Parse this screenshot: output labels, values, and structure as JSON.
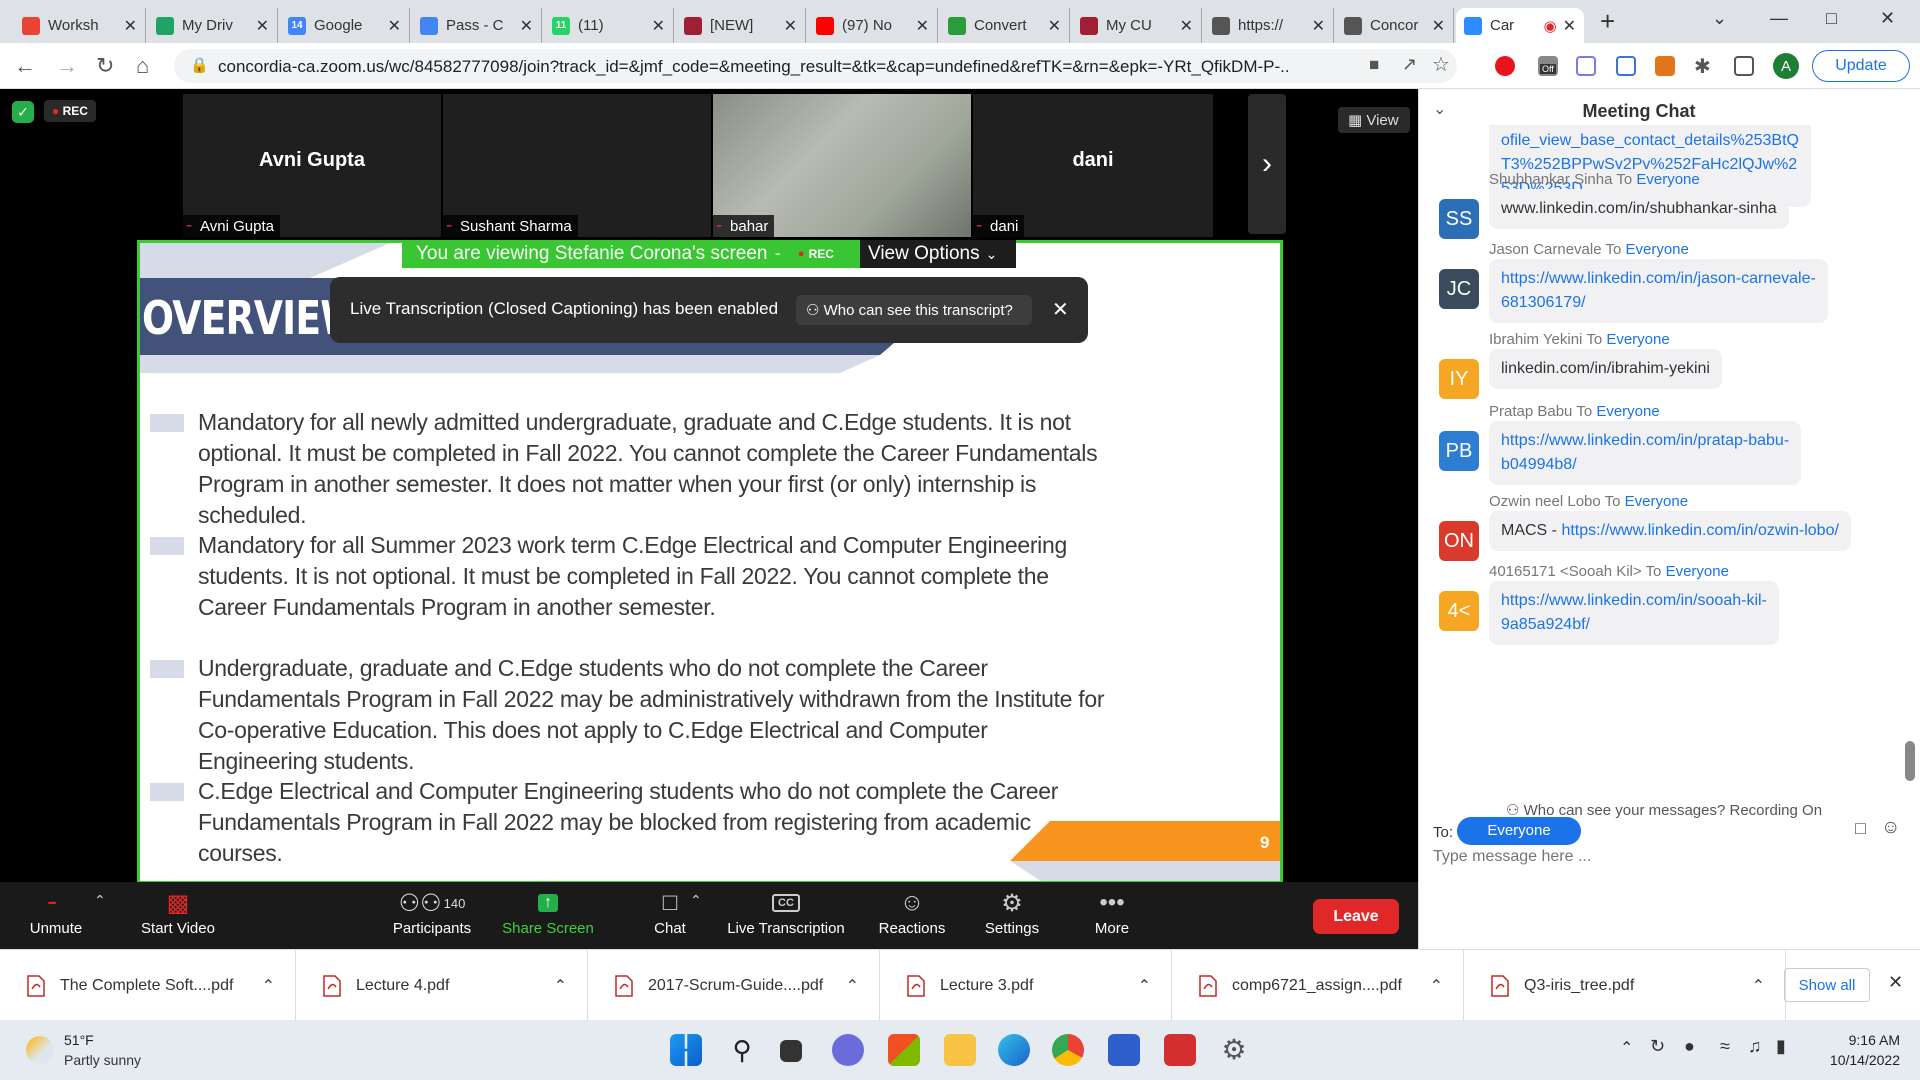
{
  "browser": {
    "tabs": [
      {
        "label": "Worksh",
        "icon": "gmail-icon",
        "color": "#ea4335"
      },
      {
        "label": "My Driv",
        "icon": "drive-icon",
        "color": "#1fa463"
      },
      {
        "label": "Google",
        "icon": "calendar-icon",
        "color": "#4285f4",
        "badge": "14"
      },
      {
        "label": "Pass - C",
        "icon": "docs-icon",
        "color": "#4285f4"
      },
      {
        "label": "(11)",
        "icon": "whatsapp-icon",
        "color": "#25d366",
        "badge": "11"
      },
      {
        "label": "[NEW]",
        "icon": "moodle-icon",
        "color": "#a01f32"
      },
      {
        "label": "(97) No",
        "icon": "youtube-icon",
        "color": "#ff0000"
      },
      {
        "label": "Convert",
        "icon": "convert-icon",
        "color": "#2a9d3a"
      },
      {
        "label": "My CU",
        "icon": "moodle-icon",
        "color": "#a01f32"
      },
      {
        "label": "https://",
        "icon": "globe-icon",
        "color": "#555555"
      },
      {
        "label": "Concor",
        "icon": "globe-icon",
        "color": "#555555"
      },
      {
        "label": "Car",
        "icon": "zoom-icon",
        "color": "#2d8cff"
      }
    ],
    "url": "concordia-ca.zoom.us/wc/84582777098/join?track_id=&jmf_code=&meeting_result=&tk=&cap=undefined&refTK=&rn=&epk=-YRt_QfikDM-P-...",
    "update_label": "Update",
    "profile_letter": "A",
    "off_badge": "Off"
  },
  "zoom": {
    "rec_label": "REC",
    "view_label": "View",
    "participants": [
      {
        "big_name": "Avni Gupta",
        "label": "Avni Gupta"
      },
      {
        "big_name": "",
        "label": "Sushant Sharma"
      },
      {
        "big_name": "",
        "label": "bahar"
      },
      {
        "big_name": "dani",
        "label": "dani"
      }
    ],
    "viewing_text": "You are viewing Stefanie Corona's screen",
    "view_options": "View Options",
    "toast_text": "Live Transcription (Closed Captioning) has been enabled",
    "toast_button": "Who can see this transcript?",
    "slide": {
      "title": "OVERVIEW",
      "bullets": [
        "Mandatory for all newly admitted undergraduate, graduate and C.Edge students. It is not optional. It must be completed in Fall 2022. You cannot complete the Career Fundamentals Program in another semester. It does not matter when your first (or only) internship is scheduled.",
        "Mandatory for all Summer 2023 work term C.Edge Electrical and Computer Engineering students. It is not optional. It must be completed in Fall 2022. You cannot complete the Career Fundamentals Program in another semester.",
        "Undergraduate, graduate and C.Edge students who do not complete the Career Fundamentals Program in Fall 2022 may be administratively withdrawn from the Institute for Co-operative Education. This does not apply to C.Edge Electrical and Computer Engineering students.",
        "C.Edge Electrical and Computer Engineering students who do not complete the Career Fundamentals Program in Fall 2022 may be blocked from registering from academic courses."
      ],
      "page_number": "9"
    },
    "toolbar": {
      "unmute": "Unmute",
      "start_video": "Start Video",
      "participants": "Participants",
      "participant_count": "140",
      "share_screen": "Share Screen",
      "chat": "Chat",
      "live_transcription": "Live Transcription",
      "cc": "CC",
      "reactions": "Reactions",
      "settings": "Settings",
      "more": "More",
      "leave": "Leave"
    }
  },
  "chat": {
    "title": "Meeting Chat",
    "partial_message": "ofile_view_base_contact_details%253BtQT3%252BPPwSv2Pv%252FaHc2lQJw%253D%253D",
    "to_word": "To",
    "everyone": "Everyone",
    "messages": [
      {
        "sender": "Shubhankar Sinha",
        "initials": "SS",
        "color": "#2d6fb6",
        "line1": "www.linkedin.com/in/shubhankar-sinha",
        "line2": "",
        "link": false,
        "prefix": ""
      },
      {
        "sender": "Jason Carnevale",
        "initials": "JC",
        "color": "#3b4a5c",
        "line1": "https://www.linkedin.com/in/jason-carnevale-",
        "line2": "681306179/",
        "link": true,
        "prefix": ""
      },
      {
        "sender": "Ibrahim Yekini",
        "initials": "IY",
        "color": "#f5a623",
        "line1": "linkedin.com/in/ibrahim-yekini",
        "line2": "",
        "link": false,
        "prefix": ""
      },
      {
        "sender": "Pratap Babu",
        "initials": "PB",
        "color": "#2d7dd2",
        "line1": "https://www.linkedin.com/in/pratap-babu-",
        "line2": "b04994b8/",
        "link": true,
        "prefix": ""
      },
      {
        "sender": "Ozwin neel Lobo",
        "initials": "ON",
        "color": "#d93a2b",
        "line1": "https://www.linkedin.com/in/ozwin-lobo/",
        "line2": "",
        "link": true,
        "prefix": "MACS - "
      },
      {
        "sender": "40165171 <Sooah Kil>",
        "initials": "4<",
        "color": "#f5a623",
        "line1": "https://www.linkedin.com/in/sooah-kil-",
        "line2": "9a85a924bf/",
        "link": true,
        "prefix": ""
      }
    ],
    "privacy": "Who can see your messages? Recording On",
    "to_label": "To:",
    "to_value": "Everyone",
    "placeholder": "Type message here ..."
  },
  "downloads": {
    "items": [
      "The Complete Soft....pdf",
      "Lecture 4.pdf",
      "2017-Scrum-Guide....pdf",
      "Lecture 3.pdf",
      "comp6721_assign....pdf",
      "Q3-iris_tree.pdf"
    ],
    "show_all": "Show all"
  },
  "taskbar": {
    "temp": "51°F",
    "weather": "Partly sunny",
    "time": "9:16 AM",
    "date": "10/14/2022"
  }
}
